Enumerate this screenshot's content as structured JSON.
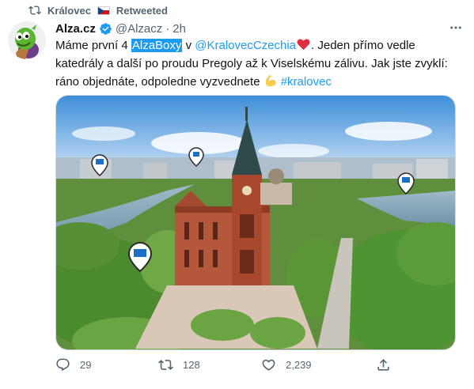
{
  "retweet": {
    "by": "Královec",
    "label": "Retweeted",
    "icon": "retweet-icon"
  },
  "tweet": {
    "author": {
      "name": "Alza.cz",
      "handle": "@Alzacz",
      "verified": true,
      "time": "2h"
    },
    "text_parts": {
      "p1": "Máme první 4 ",
      "p2": "AlzaBoxy",
      "p3": " v ",
      "p4": "@KralovecCzechia",
      "p5": ". Jeden přímo vedle katedrály a další po proudu Pregoly až k Viselskému zálivu. Jak jste zvyklí: ráno objednáte, odpoledne vyzvednete ",
      "p6": "#kralovec"
    },
    "emoji": {
      "heart": "red-heart",
      "arm": "flexed-biceps"
    }
  },
  "actions": {
    "reply": {
      "count": "29",
      "icon": "reply-icon"
    },
    "retweet": {
      "count": "128",
      "icon": "retweet-icon"
    },
    "like": {
      "count": "2,239",
      "icon": "heart-icon"
    },
    "share": {
      "icon": "share-icon"
    }
  },
  "colors": {
    "accent": "#1d9bf0",
    "text": "#0f1419",
    "muted": "#536471",
    "verified": "#1d9bf0"
  }
}
